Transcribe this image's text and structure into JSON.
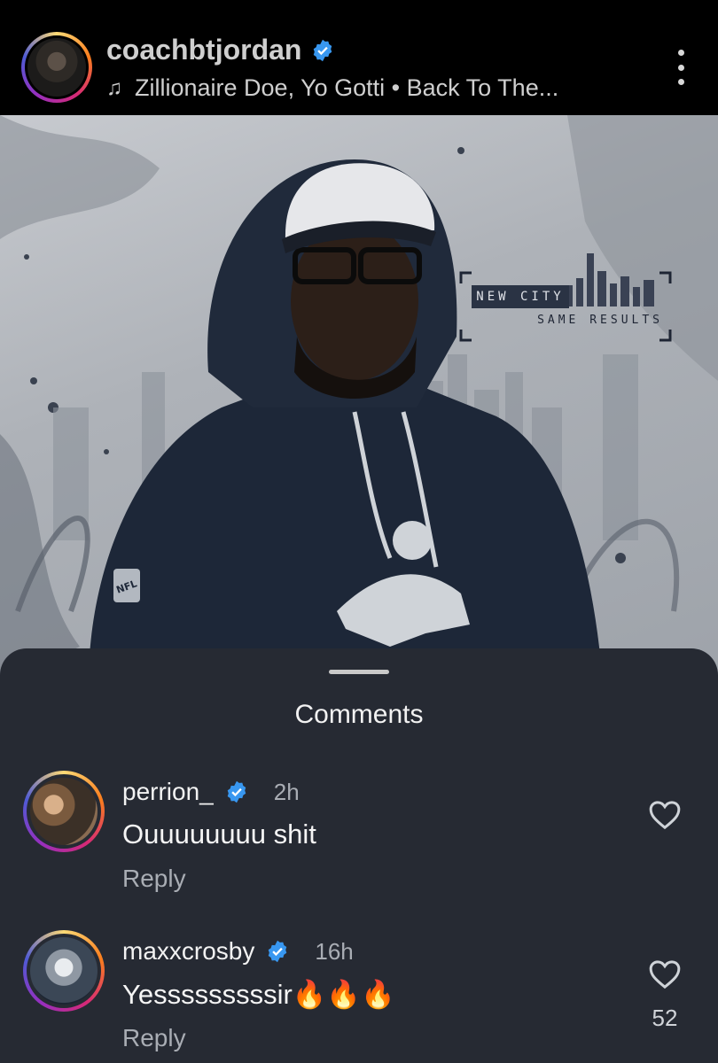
{
  "header": {
    "username": "coachbtjordan",
    "audio": "Zillionaire Doe, Yo Gotti • Back To The...",
    "icons": {
      "verified": "verified-badge-icon",
      "music": "music-note-icon",
      "more": "more-options-icon"
    }
  },
  "post": {
    "overlay_line1": "NEW CITY",
    "overlay_line2": "SAME RESULTS",
    "jersey_text": "NFL"
  },
  "comments_sheet": {
    "title": "Comments",
    "comments": [
      {
        "username": "perrion_",
        "time": "2h",
        "text": "Ouuuuuuuu shit",
        "reply": "Reply",
        "likes": ""
      },
      {
        "username": "maxxcrosby",
        "time": "16h",
        "text": "Yesssssssssir🔥🔥🔥",
        "reply": "Reply",
        "likes": "52"
      }
    ]
  },
  "colors": {
    "background": "#000000",
    "sheet": "#262a33",
    "verified_blue": "#3897f0",
    "muted_text": "#a9adb4"
  }
}
